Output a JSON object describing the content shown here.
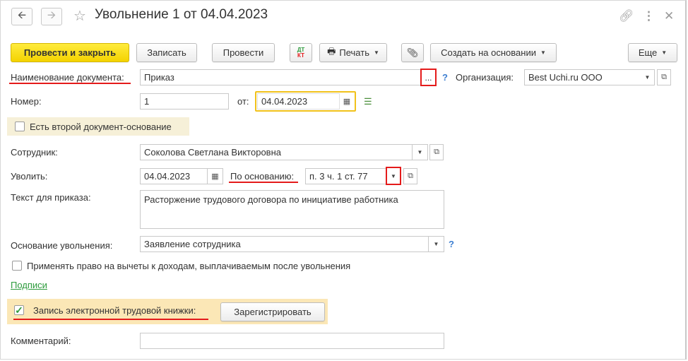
{
  "window": {
    "title": "Увольнение 1 от 04.04.2023",
    "back_icon": "arrow-left-icon",
    "forward_icon": "arrow-right-icon"
  },
  "toolbar": {
    "post_close_label": "Провести и закрыть",
    "save_label": "Записать",
    "post_label": "Провести",
    "dt_kt_top": "ДТ",
    "dt_kt_bottom": "КТ",
    "print_label": "Печать",
    "create_based_label": "Создать на основании",
    "more_label": "Еще"
  },
  "form": {
    "doc_name_label": "Наименование документа:",
    "doc_name_value": "Приказ",
    "ellipsis": "...",
    "help": "?",
    "org_label": "Организация:",
    "org_value": "Best Uchi.ru ООО",
    "number_label": "Номер:",
    "number_value": "1",
    "from_label": "от:",
    "date_value": "04.04.2023",
    "second_doc_label": "Есть второй документ-основание",
    "employee_label": "Сотрудник:",
    "employee_value": "Соколова Светлана Викторовна",
    "dismiss_label": "Уволить:",
    "dismiss_date": "04.04.2023",
    "basis_label": "По основанию:",
    "basis_value": "п. 3 ч. 1 ст. 77",
    "order_text_label": "Текст для приказа:",
    "order_text_value": "Расторжение трудового договора по инициативе работника",
    "dismiss_reason_label": "Основание увольнения:",
    "dismiss_reason_value": "Заявление сотрудника",
    "deductions_label": "Применять право на вычеты к доходам, выплачиваемым после увольнения",
    "signatures_link": "Подписи",
    "etk_label": "Запись электронной трудовой книжки:",
    "etk_checked": true,
    "register_label": "Зарегистрировать",
    "comment_label": "Комментарий:",
    "comment_value": ""
  },
  "colors": {
    "primary_button": "#f4d300",
    "highlight_row": "#fbe7b6",
    "annotation_red": "#e41b1b",
    "link_green": "#2d9b3c"
  }
}
